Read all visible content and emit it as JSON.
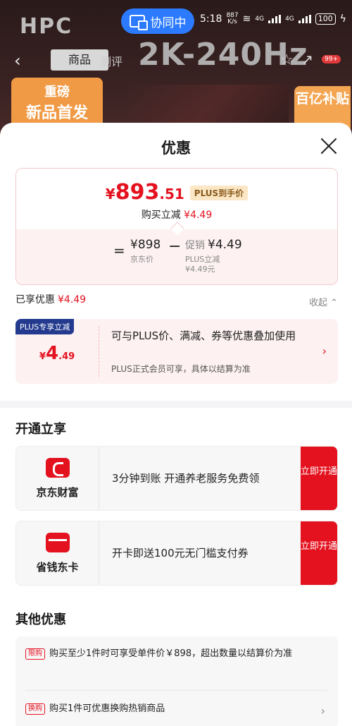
{
  "status": {
    "cast_label": "协同中",
    "time": "5:18",
    "net_speed_top": "887",
    "net_speed_unit": "K/s",
    "net_4g_1": "4G",
    "net_4g_2": "4G",
    "battery": "100"
  },
  "background": {
    "brand": "HPC",
    "back_glyph": "‹",
    "tab_active": "商品",
    "tab_other": "测评",
    "hero_text": "2K-240Hz",
    "badge_count": "99+",
    "promo_left_1": "重磅",
    "promo_left_2": "新品首发",
    "promo_right": "百亿补贴"
  },
  "sheet": {
    "title": "优惠",
    "price_card": {
      "yen": "¥",
      "price_int": "893",
      "price_dec": ".51",
      "plus_tag": "PLUS到手价",
      "subtitle": "购买立减",
      "subtitle_amount": "¥4.49",
      "eq": "=",
      "orig_price": "¥898",
      "orig_label": "京东价",
      "minus": "−",
      "promo_label": "促销",
      "promo_amount": "¥4.49",
      "promo_sub1": "PLUS立减",
      "promo_sub2": "¥4.49元"
    },
    "enjoyed_label": "已享优惠",
    "enjoyed_amount": "¥4.49",
    "collapse_label": "收起 ⌃",
    "plus_card": {
      "badge": "PLUS专享立减",
      "yen": "¥",
      "amount_int": "4",
      "amount_dec": ".49",
      "text": "可与PLUS价、满减、券等优惠叠加使用",
      "note": "PLUS正式会员可享，具体以结算为准",
      "chevron": "›"
    },
    "section_open_title": "开通立享",
    "services": [
      {
        "name": "京东财富",
        "desc": "3分钟到账 开通养老服务免费领",
        "button": "立即开通"
      },
      {
        "name": "省钱东卡",
        "desc": "开卡即送100元无门槛支付券",
        "button": "立即开通"
      }
    ],
    "section_other_title": "其他优惠",
    "other": [
      {
        "tag": "限购",
        "text": "购买至少1件时可享受单件价￥898，超出数量以结算价为准"
      },
      {
        "tag": "换购",
        "text": "购买1件可优惠换购热销商品",
        "chevron": "›"
      }
    ]
  }
}
